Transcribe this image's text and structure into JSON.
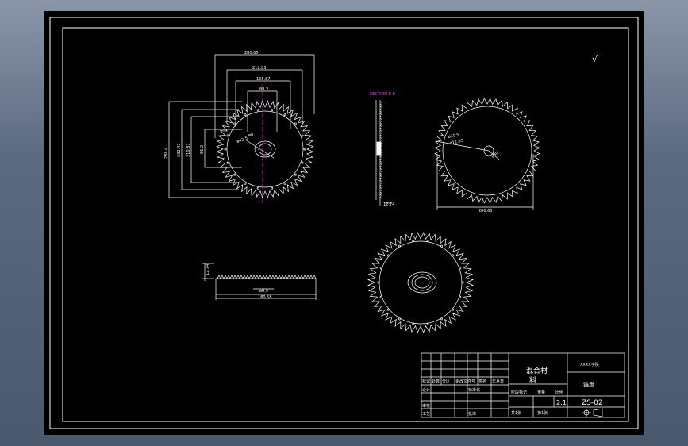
{
  "colors": {
    "background": "#000000",
    "line": "#ffffff",
    "accent": "#ff33ff",
    "frame": "#5c6a80"
  },
  "gear": {
    "teeth": 56,
    "bolt_holes": 18
  },
  "front_view": {
    "dims_horizontal": [
      "280.65",
      "212.85",
      "165.87",
      "88.2"
    ],
    "dims_vertical": [
      "288.4",
      "232.47",
      "210.87",
      "86.2"
    ],
    "hole_diameter": "ø42.5",
    "hub_label": "ø8"
  },
  "section_view": {
    "title": "SECTION E-E",
    "thickness": "12.74"
  },
  "right_view": {
    "dim_width": "280.65",
    "r1": "ø30.5",
    "r2": "ø12.83",
    "hole": "ø30"
  },
  "bottom_left_view": {
    "thickness": "12.74",
    "hub": "ø8.5",
    "width": "180.58"
  },
  "roughness_symbol": "√",
  "title_block": {
    "material": "混合材料",
    "material_line1": "混合材",
    "material_line2": "料",
    "company": "XXXX学院",
    "part_name": "链盘",
    "scale": "2:1",
    "drawing_no": "ZS-02",
    "row_labels": [
      "标记",
      "设计",
      "审核",
      "工艺"
    ],
    "header_cells": [
      "处数",
      "分区",
      "更改文件号",
      "签名",
      "年月日"
    ],
    "standardize": "标准化",
    "approve": "批准",
    "stage_mark": "阶段标记",
    "weight": "重量",
    "ratio": "比例",
    "sheets_total": "共1张",
    "sheet_no": "第1张"
  }
}
